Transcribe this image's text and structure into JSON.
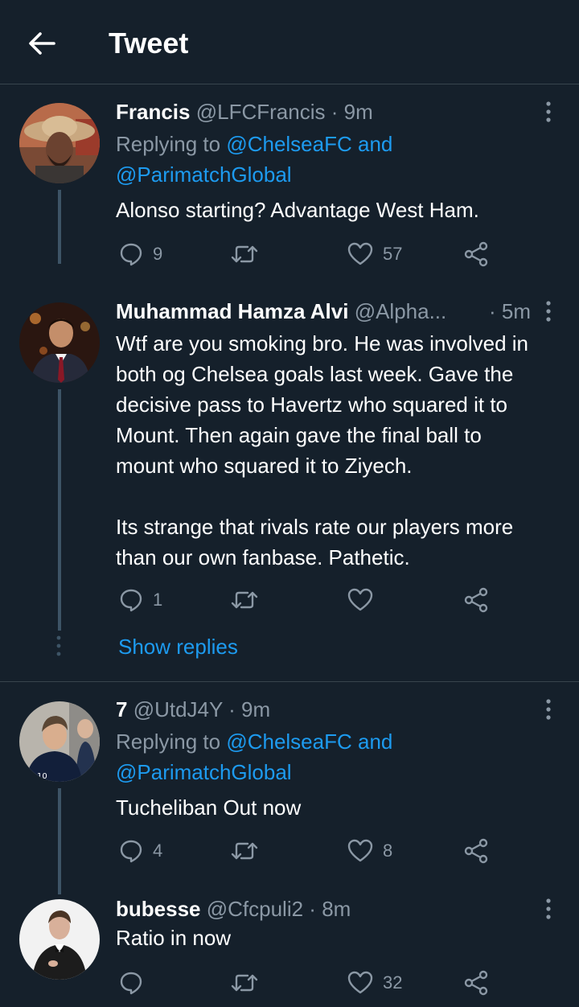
{
  "header": {
    "title": "Tweet"
  },
  "tweets": [
    {
      "name": "Francis",
      "handle": "@LFCFrancis",
      "time": "9m",
      "replying_prefix": "Replying to ",
      "replying_users": "@ChelseaFC and",
      "replying_users2": "@ParimatchGlobal",
      "text": "Alonso starting? Advantage West Ham.",
      "replies": "9",
      "retweets": "",
      "likes": "57"
    },
    {
      "name": "Muhammad Hamza Alvi",
      "handle": "@Alpha...",
      "time": "· 5m",
      "text": "Wtf are you smoking bro. He was involved in\nboth og Chelsea goals last week. Gave the\ndecisive pass to Havertz who squared it to\nMount. Then again gave the final ball to\nmount who squared it to Ziyech.\n\nIts strange that rivals rate our players more\nthan our own fanbase. Pathetic.",
      "replies": "1",
      "retweets": "",
      "likes": ""
    },
    {
      "name": "7",
      "handle": "@UtdJ4Y",
      "time": "9m",
      "replying_prefix": "Replying to ",
      "replying_users": "@ChelseaFC and",
      "replying_users2": "@ParimatchGlobal",
      "text": "Tucheliban Out now",
      "replies": "4",
      "retweets": "",
      "likes": "8"
    },
    {
      "name": "bubesse",
      "handle": "@Cfcpuli2",
      "time": "8m",
      "text": "Ratio in now",
      "replies": "",
      "retweets": "",
      "likes": "32"
    }
  ],
  "show_replies_label": "Show replies",
  "colors": {
    "background": "#15202b",
    "link": "#1d9bf0",
    "secondary_text": "#8b98a5",
    "divider": "#38444d"
  }
}
